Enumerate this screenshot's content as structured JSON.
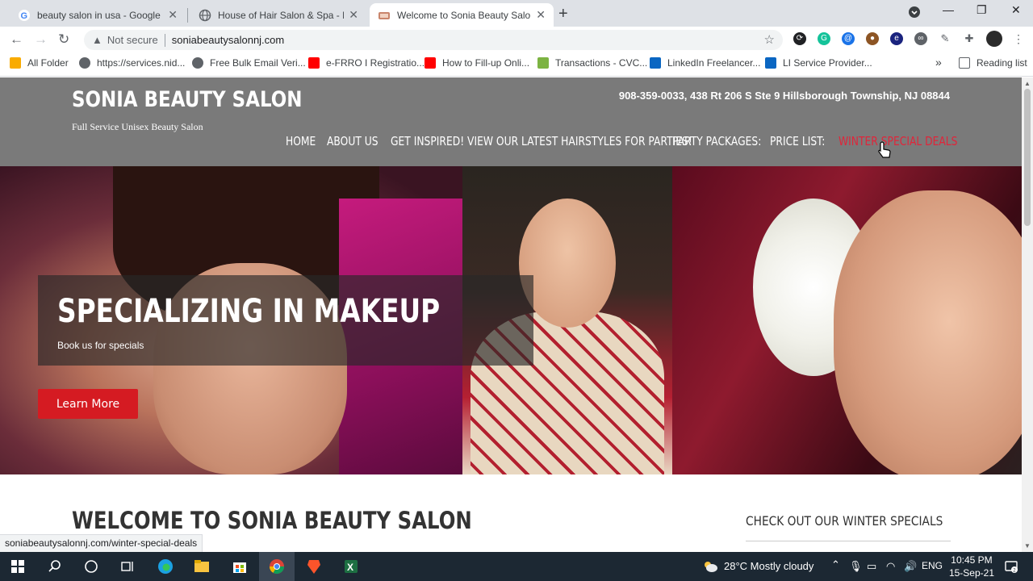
{
  "browser": {
    "tabs": [
      {
        "title": "beauty salon in usa - Google Sea",
        "active": false
      },
      {
        "title": "House of Hair Salon & Spa - Broo",
        "active": false
      },
      {
        "title": "Welcome to Sonia Beauty Salon-",
        "active": true
      }
    ],
    "new_tab_glyph": "+",
    "not_secure_label": "Not secure",
    "url": "soniabeautysalonnj.com",
    "bookmarks": [
      "All Folder",
      "https://services.nid...",
      "Free Bulk Email Veri...",
      "e-FRRO I Registratio...",
      "How to Fill-up Onli...",
      "Transactions - CVC...",
      "LinkedIn Freelancer...",
      "LI Service Provider..."
    ],
    "more_bookmarks": "»",
    "reading_list": "Reading list",
    "status_url": "soniabeautysalonnj.com/winter-special-deals"
  },
  "site": {
    "logo": "SONIA BEAUTY SALON",
    "tagline": "Full Service Unisex Beauty Salon",
    "contact": "908-359-0033, 438 Rt 206 S Ste 9 Hillsborough Township, NJ 08844",
    "nav": [
      "HOME",
      "ABOUT US",
      "GET INSPIRED! VIEW OUR LATEST HAIRSTYLES FOR PARTIES!",
      "PARTY PACKAGES:",
      "PRICE LIST:",
      "WINTER SPECIAL DEALS"
    ],
    "hero": {
      "title": "SPECIALIZING IN MAKEUP",
      "subtitle": "Book us for specials",
      "button": "Learn More"
    },
    "welcome_heading": "WELCOME TO SONIA BEAUTY SALON",
    "sidebar_heading": "CHECK OUT OUR WINTER SPECIALS"
  },
  "taskbar": {
    "weather": "28°C  Mostly cloudy",
    "language": "ENG",
    "time": "10:45 PM",
    "date": "15-Sep-21"
  },
  "colors": {
    "header_bg": "#7a7a7a",
    "accent_red": "#d51b22",
    "nav_special": "#e0253a"
  }
}
